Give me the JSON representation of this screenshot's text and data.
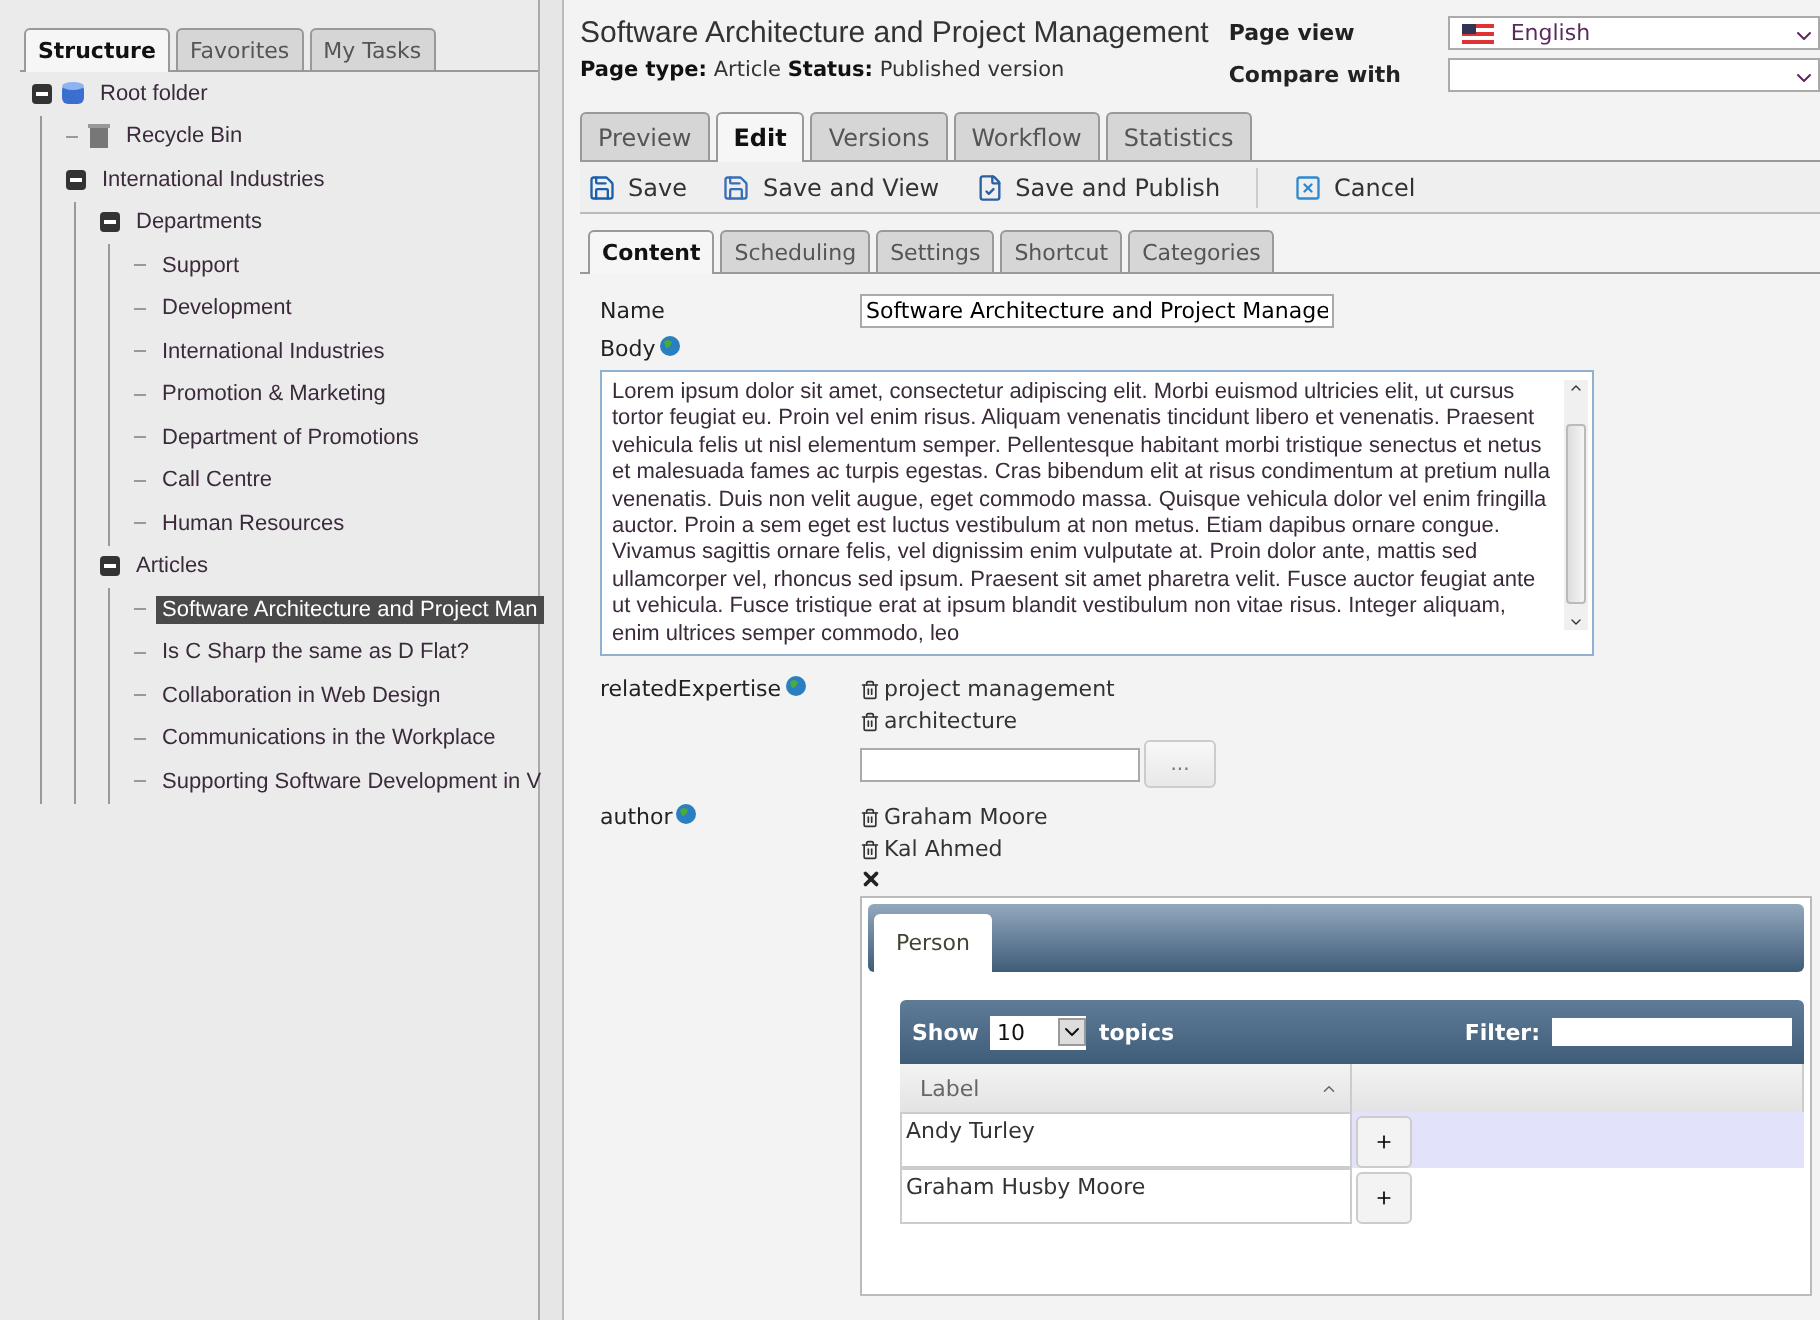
{
  "sidebar": {
    "tabs": [
      {
        "label": "Structure",
        "selected": true
      },
      {
        "label": "Favorites",
        "selected": false
      },
      {
        "label": "My Tasks",
        "selected": false
      }
    ],
    "tree": [
      {
        "label": "Root folder",
        "kind": "root",
        "expanded": true,
        "selected": false,
        "children": [
          {
            "label": "Recycle Bin",
            "kind": "bin",
            "selected": false
          },
          {
            "label": "International Industries",
            "expanded": true,
            "selected": false,
            "children": [
              {
                "label": "Departments",
                "expanded": true,
                "selected": false,
                "children": [
                  {
                    "label": "Support",
                    "selected": false
                  },
                  {
                    "label": "Development",
                    "selected": false
                  },
                  {
                    "label": "International Industries",
                    "selected": false
                  },
                  {
                    "label": "Promotion & Marketing",
                    "selected": false
                  },
                  {
                    "label": "Department of Promotions",
                    "selected": false
                  },
                  {
                    "label": "Call Centre",
                    "selected": false
                  },
                  {
                    "label": "Human Resources",
                    "selected": false
                  }
                ]
              },
              {
                "label": "Articles",
                "expanded": true,
                "selected": false,
                "children": [
                  {
                    "label": "Software Architecture and Project Man",
                    "selected": true
                  },
                  {
                    "label": "Is C Sharp the same as D Flat?",
                    "selected": false
                  },
                  {
                    "label": "Collaboration in Web Design",
                    "selected": false
                  },
                  {
                    "label": "Communications in the Workplace",
                    "selected": false
                  },
                  {
                    "label": "Supporting Software Development in V",
                    "selected": false
                  }
                ]
              }
            ]
          }
        ]
      }
    ]
  },
  "header": {
    "title": "Software Architecture and Project Management",
    "meta": "**Page type:** Article **Status:** Published version",
    "page_view_label": "Page view",
    "page_view_value": "English",
    "compare_label": "Compare with"
  },
  "main_tabs": [
    {
      "label": "Preview",
      "selected": false
    },
    {
      "label": "Edit",
      "selected": true
    },
    {
      "label": "Versions",
      "selected": false
    },
    {
      "label": "Workflow",
      "selected": false
    },
    {
      "label": "Statistics",
      "selected": false
    }
  ],
  "toolbar": [
    {
      "label": "Save",
      "kind": "save"
    },
    {
      "label": "Save and View",
      "kind": "view"
    },
    {
      "label": "Save and Publish",
      "kind": "publish"
    },
    {
      "label": "Cancel",
      "kind": "cancel"
    }
  ],
  "content_tabs": [
    {
      "label": "Content",
      "selected": true
    },
    {
      "label": "Scheduling",
      "selected": false
    },
    {
      "label": "Settings",
      "selected": false
    },
    {
      "label": "Shortcut",
      "selected": false
    },
    {
      "label": "Categories",
      "selected": false
    }
  ],
  "form": {
    "name_label": "Name",
    "name_value": "Software Architecture and Project Manage",
    "body_label": "Body",
    "body_text": "Lorem ipsum dolor sit amet, consectetur adipiscing elit. Morbi euismod ultricies elit, ut cursus tortor feugiat eu. Proin vel enim risus. Aliquam venenatis tincidunt libero et venenatis. Praesent vehicula felis ut nisl elementum semper. Pellentesque habitant morbi tristique senectus et netus et malesuada fames ac turpis egestas. Cras bibendum elit at risus condimentum at pretium nulla venenatis. Duis non velit augue, eget commodo massa. Quisque vehicula dolor vel enim fringilla auctor. Proin a sem eget est luctus vestibulum at non metus. Etiam dapibus ornare congue. Vivamus sagittis ornare felis, vel dignissim enim vulputate at. Proin dolor ante, mattis sed ullamcorper vel, rhoncus sed ipsum. Praesent sit amet pharetra velit. Fusce auctor feugiat ante ut vehicula. Fusce tristique erat at ipsum blandit vestibulum non vitae risus. Integer aliquam, enim ultrices semper commodo, leo",
    "expertise_label": "relatedExpertise",
    "expertise": [
      "project management",
      "architecture"
    ],
    "browse_button": "...",
    "author_label": "author",
    "authors": [
      "Graham Moore",
      "Kal Ahmed"
    ]
  },
  "picker": {
    "tab": "Person",
    "show_label": "Show",
    "page_size": "10",
    "topics_label": "topics",
    "filter_label": "Filter:",
    "column": "Label",
    "rows": [
      {
        "label": "Andy Turley",
        "selected": true
      },
      {
        "label": "Graham Husby Moore",
        "selected": false
      }
    ]
  }
}
